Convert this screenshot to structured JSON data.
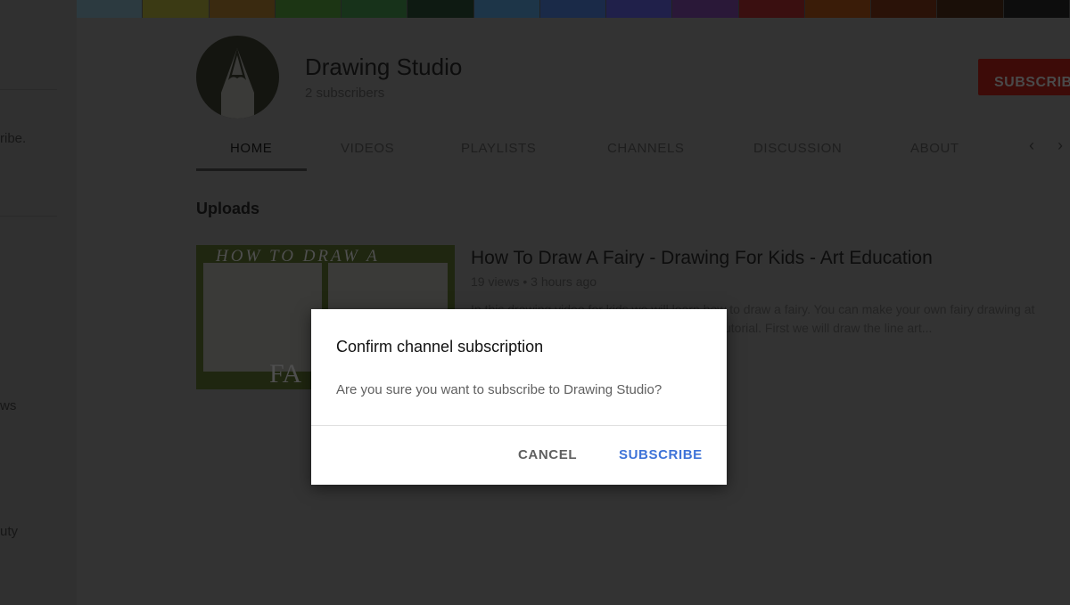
{
  "sidebar": {
    "fragments": [
      "ribe.",
      "ws",
      "uty"
    ]
  },
  "banner": {
    "colors": [
      "#2c3a40",
      "#3b3a14",
      "#3a2a10",
      "#1c3514",
      "#17321a",
      "#0e1a12",
      "#1d3548",
      "#1a2a48",
      "#20204a",
      "#2a1838",
      "#3a0f10",
      "#3a1c08",
      "#2a1208",
      "#1a0f08",
      "#0d0d0d"
    ]
  },
  "channel": {
    "name": "Drawing Studio",
    "subscribers": "2 subscribers",
    "subscribe_label": "SUBSCRIBE",
    "subscribe_color": "#3d0b08"
  },
  "tabs": [
    {
      "label": "HOME",
      "active": true
    },
    {
      "label": "VIDEOS"
    },
    {
      "label": "PLAYLISTS"
    },
    {
      "label": "CHANNELS"
    },
    {
      "label": "DISCUSSION"
    },
    {
      "label": "ABOUT"
    }
  ],
  "tab_scroll": {
    "left": "‹",
    "right": "›"
  },
  "uploads": {
    "heading": "Uploads",
    "video": {
      "thumb_title": "HOW TO DRAW A",
      "thumb_word": "FA",
      "title": "How To Draw A Fairy - Drawing For Kids - Art Education",
      "meta": "19 views • 3 hours ago",
      "desc_line1": "In this drawing video for kids we will learn how to draw a fairy. You can make your own fairy drawing at",
      "desc_line2": "utorial. First we will draw the line art..."
    }
  },
  "dialog": {
    "title": "Confirm channel subscription",
    "message": "Are you sure you want to subscribe to Drawing Studio?",
    "cancel_label": "CANCEL",
    "confirm_label": "SUBSCRIBE",
    "confirm_color": "#3e73d8"
  }
}
